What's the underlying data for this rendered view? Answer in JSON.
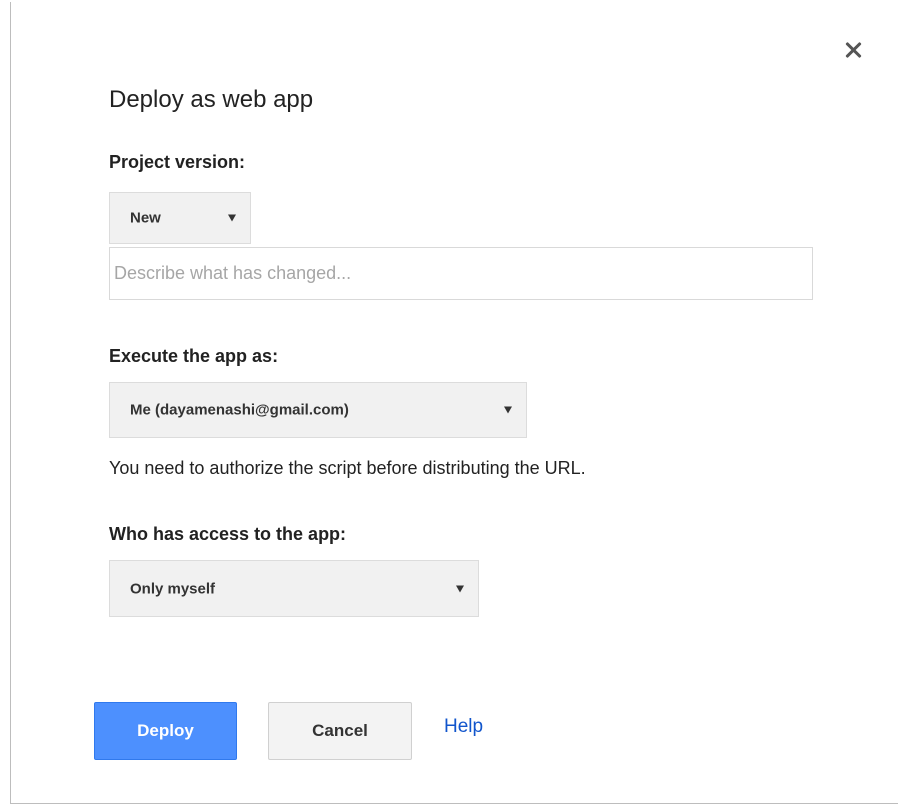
{
  "dialog": {
    "title": "Deploy as web app",
    "close_icon": "close-icon"
  },
  "project_version": {
    "label": "Project version:",
    "selected": "New",
    "description_placeholder": "Describe what has changed...",
    "description_value": ""
  },
  "execute_as": {
    "label": "Execute the app as:",
    "selected": "Me (dayamenashi@gmail.com)",
    "note": "You need to authorize the script before distributing the URL."
  },
  "access": {
    "label": "Who has access to the app:",
    "selected": "Only myself"
  },
  "buttons": {
    "deploy": "Deploy",
    "cancel": "Cancel",
    "help": "Help"
  },
  "colors": {
    "primary_button": "#4d90fe",
    "link": "#1155cc"
  }
}
